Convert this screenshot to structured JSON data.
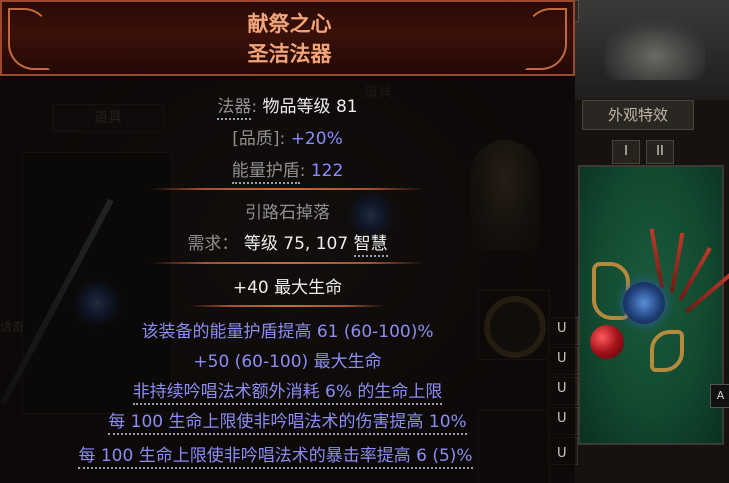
{
  "item": {
    "name": "献祭之心",
    "base": "圣洁法器",
    "type_label": "法器",
    "item_level_text": "物品等级 81",
    "quality_label": "[品质]",
    "quality_value": "+20%",
    "es_label": "能量护盾",
    "es_value": "122",
    "source_text": "引路石掉落",
    "req_label": "需求：",
    "req_level_text": "等级 75,",
    "req_int_value": "107",
    "req_int_label": "智慧",
    "implicit": "+40 最大生命",
    "explicit_mods": [
      "该装备的能量护盾提高 61 (60-100)%",
      "+50 (60-100) 最大生命",
      "非持续吟唱法术额外消耗 6% 的生命上限",
      "每 100 生命上限使非吟唱法术的伤害提高 10%",
      "每 100 生命上限使非吟唱法术的暴击率提高 6 (5)%"
    ],
    "mod_tag": "U"
  },
  "background": {
    "tab_left": "道具",
    "tab_center": "道具",
    "left_label": "诱奇",
    "right_panel_title": "外观特效",
    "right_tabs": [
      "I",
      "II"
    ],
    "close_symbol": "✕",
    "corner_button": "A"
  },
  "colors": {
    "name": "#f0a47a",
    "magic_mod": "#8c8cf3",
    "label": "#8f8f8f",
    "value": "#ededed"
  }
}
